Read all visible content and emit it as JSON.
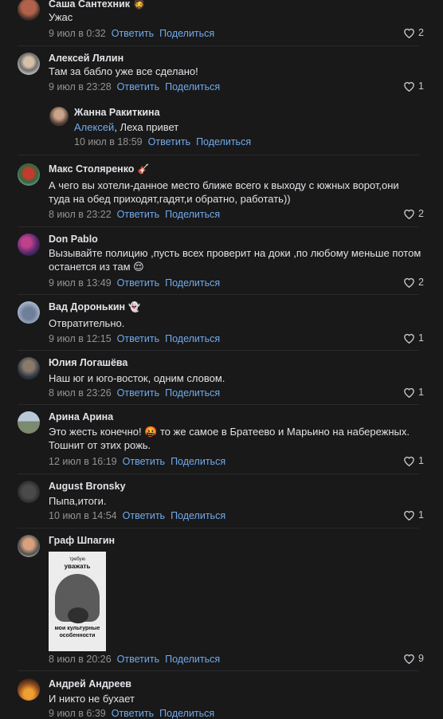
{
  "actions": {
    "reply": "Ответить",
    "share": "Поделиться"
  },
  "comments": [
    {
      "author": "Саша Сантехник",
      "emoji": "🧔",
      "text": "Ужас",
      "time": "9 июл в 0:32",
      "likes": "2"
    },
    {
      "author": "Алексей Лялин",
      "text": "Там за бабло уже все сделано!",
      "time": "9 июл в 23:28",
      "likes": "1"
    },
    {
      "author": "Жанна Ракиткина",
      "mention": "Алексей",
      "text": ", Леха привет",
      "time": "10 июл в 18:59"
    },
    {
      "author": "Макс Столяренко",
      "emoji": "🎸",
      "text": "А чего вы хотели-данное место ближе всего к выходу с южных ворот,они туда на обед приходят,гадят,и обратно, работать))",
      "time": "8 июл в 23:22",
      "likes": "2"
    },
    {
      "author": "Don Pablo",
      "text": "Вызывайте полицию ,пусть всех проверит на доки ,по любому меньше потом останется из там 😌",
      "time": "9 июл в 13:49",
      "likes": "2"
    },
    {
      "author": "Вад Доронькин",
      "emoji": "👻",
      "text": "Отвратительно.",
      "time": "9 июл в 12:15",
      "likes": "1"
    },
    {
      "author": "Юлия Логашёва",
      "text": "Наш юг и юго-восток, одним словом.",
      "time": "8 июл в 23:26",
      "likes": "1"
    },
    {
      "author": "Арина Арина",
      "text": "Это жесть конечно! 🤬 то же самое в Братеево и Марьино на набережных. Тошнит от этих рожь.",
      "time": "12 июл в 16:19",
      "likes": "1"
    },
    {
      "author": "August Bronsky",
      "text": "Пыпа,итоги.",
      "time": "10 июл в 14:54",
      "likes": "1"
    },
    {
      "author": "Граф Шпагин",
      "time": "8 июл в 20:26",
      "likes": "9",
      "photo": {
        "line1": "требую",
        "line2": "уважать",
        "line3": "мои культурные особенности"
      }
    },
    {
      "author": "Андрей Андреев",
      "text": "И никто не бухает",
      "time": "9 июл в 6:39"
    }
  ],
  "colors": {
    "background": "#19191a",
    "link": "#71aaeb",
    "meta": "#939393",
    "text": "#e1e3e6"
  }
}
